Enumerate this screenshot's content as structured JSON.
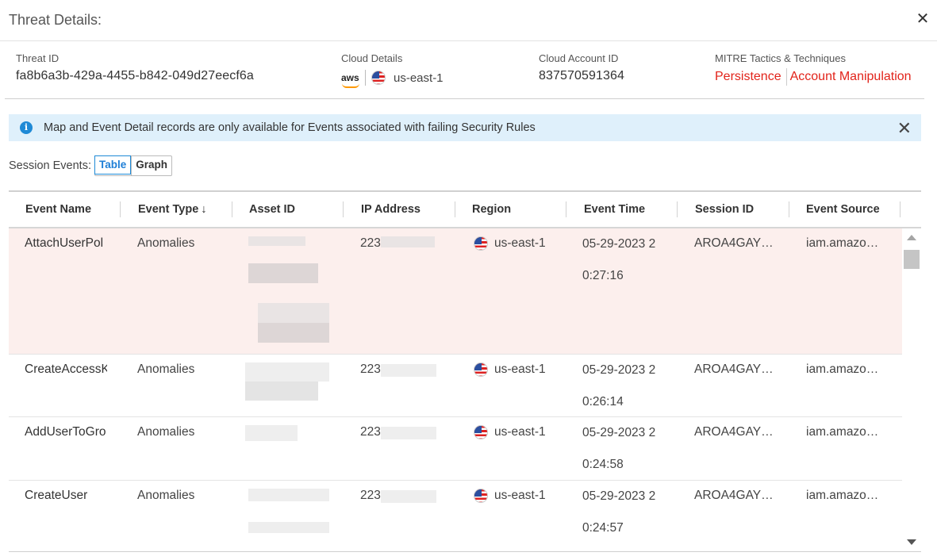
{
  "header": {
    "title": "Threat Details:",
    "close_glyph": "✕"
  },
  "details": {
    "threat_id_label": "Threat ID",
    "threat_id": "fa8b6a3b-429a-4455-b842-049d27eecf6a",
    "cloud_label": "Cloud Details",
    "cloud_provider": "aws",
    "cloud_region": "us-east-1",
    "account_label": "Cloud Account ID",
    "account_id": "837570591364",
    "mitre_label": "MITRE Tactics & Techniques",
    "mitre_tags": [
      "Persistence",
      "Account Manipulation"
    ]
  },
  "banner": {
    "icon": "info-icon",
    "message": "Map and Event Detail records are only available for Events associated with failing Security Rules",
    "close_glyph": "✕"
  },
  "session": {
    "label": "Session Events:",
    "views": [
      "Table",
      "Graph"
    ],
    "active_view": "Table"
  },
  "table": {
    "columns": [
      "Event Name",
      "Event Type",
      "Asset ID",
      "IP Address",
      "Region",
      "Event Time",
      "Session ID",
      "Event Source"
    ],
    "sorted_column": "Event Type",
    "rows": [
      {
        "name": "AttachUserPol",
        "type": "Anomalies",
        "ip": "223",
        "region": "us-east-1",
        "time": "05-29-2023 2 0:27:16",
        "session": "AROA4GAYY…",
        "source": "iam.amazo…"
      },
      {
        "name": "CreateAccessK",
        "type": "Anomalies",
        "ip": "223",
        "region": "us-east-1",
        "time": "05-29-2023 2 0:26:14",
        "session": "AROA4GAYY…",
        "source": "iam.amazo…"
      },
      {
        "name": "AddUserToGro",
        "type": "Anomalies",
        "ip": "223",
        "region": "us-east-1",
        "time": "05-29-2023 2 0:24:58",
        "session": "AROA4GAYY…",
        "source": "iam.amazo…"
      },
      {
        "name": "CreateUser",
        "type": "Anomalies",
        "ip": "223",
        "region": "us-east-1",
        "time": "05-29-2023 2 0:24:57",
        "session": "AROA4GAYY…",
        "source": "iam.amazo…"
      }
    ]
  },
  "colors": {
    "accent": "#1f8ad6",
    "mitre_red": "#e2231a",
    "alert_row": "#fcefed",
    "banner_bg": "#dff0fb"
  }
}
